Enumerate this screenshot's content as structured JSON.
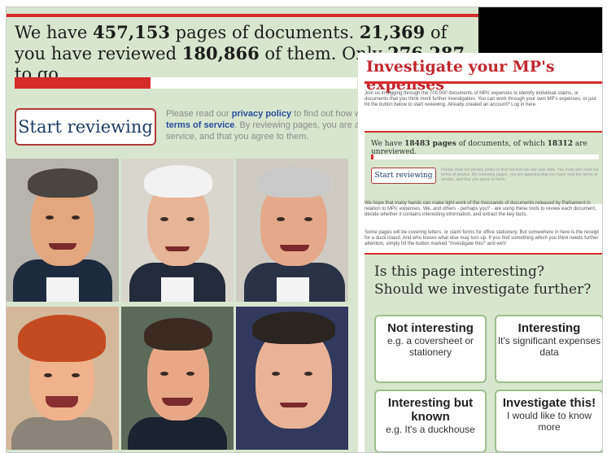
{
  "main": {
    "headline_lead": "We have",
    "total_pages": "457,153",
    "headline_mid1": "pages of documents.",
    "reviewers": "21,369",
    "headline_mid2": "of you have reviewed",
    "reviewed_pages": "180,866",
    "headline_mid3": "of them. Only",
    "remaining_pages": "276,287",
    "headline_tail": "to go...",
    "progress_fraction": 0.396,
    "start_label": "Start reviewing",
    "privacy_pre": "Please read our",
    "privacy_link": "privacy policy",
    "privacy_mid": "to find out how w",
    "terms_link": "terms of service",
    "privacy_post": ". By reviewing pages, you are a service, and that you agree to them."
  },
  "photos": [
    {
      "name": "person-1"
    },
    {
      "name": "person-2"
    },
    {
      "name": "person-3"
    },
    {
      "name": "person-4"
    },
    {
      "name": "person-5"
    },
    {
      "name": "person-6"
    }
  ],
  "panel": {
    "title": "Investigate your MP's expenses",
    "intro": "Join us in digging through the 700,000 documents of MPs' expenses to identify individual claims, or documents that you think merit further investigation. You can work through your own MP's expenses, or just hit the button below to start reviewing. Already created an account? Log in here.",
    "stats_lead": "We have",
    "stats_pages": "18483 pages",
    "stats_mid": "of documents, of which",
    "stats_reviewed": "18312",
    "stats_tail": "are unreviewed.",
    "progress_fraction": 0.01,
    "start_label": "Start reviewing",
    "privacy": "Please read our privacy policy to find out how we use your data. You must also read our terms of service. By reviewing pages, you are agreeing that you have read the terms of service, and that you agree to them.",
    "para1": "We hope that many hands can make light work of the thousands of documents released by Parliament in relation to MPs' expenses. We, and others - perhaps you? - are using these tools to review each document, decide whether it contains interesting information, and extract the key facts.",
    "para2": "Some pages will be covering letters, or claim forms for office stationery. But somewhere in here is the receipt for a duck island. And who knows what else may turn up. If you find something which you think needs further attention, simply hit the button marked \"Investigate this!\" and we'll",
    "question": "Is this page interesting? Should we investigate further?",
    "choices": [
      {
        "title": "Not interesting",
        "sub": "e.g. a coversheet or stationery"
      },
      {
        "title": "Interesting",
        "sub": "It's significant expenses data"
      },
      {
        "title": "Interesting but known",
        "sub": "e.g. It's a duckhouse"
      },
      {
        "title": "Investigate this!",
        "sub": "I would like to know more"
      }
    ]
  },
  "colors": {
    "accent_red": "#d62b2b",
    "panel_green": "#d8e6cf",
    "link_blue": "#2a4d9a"
  }
}
